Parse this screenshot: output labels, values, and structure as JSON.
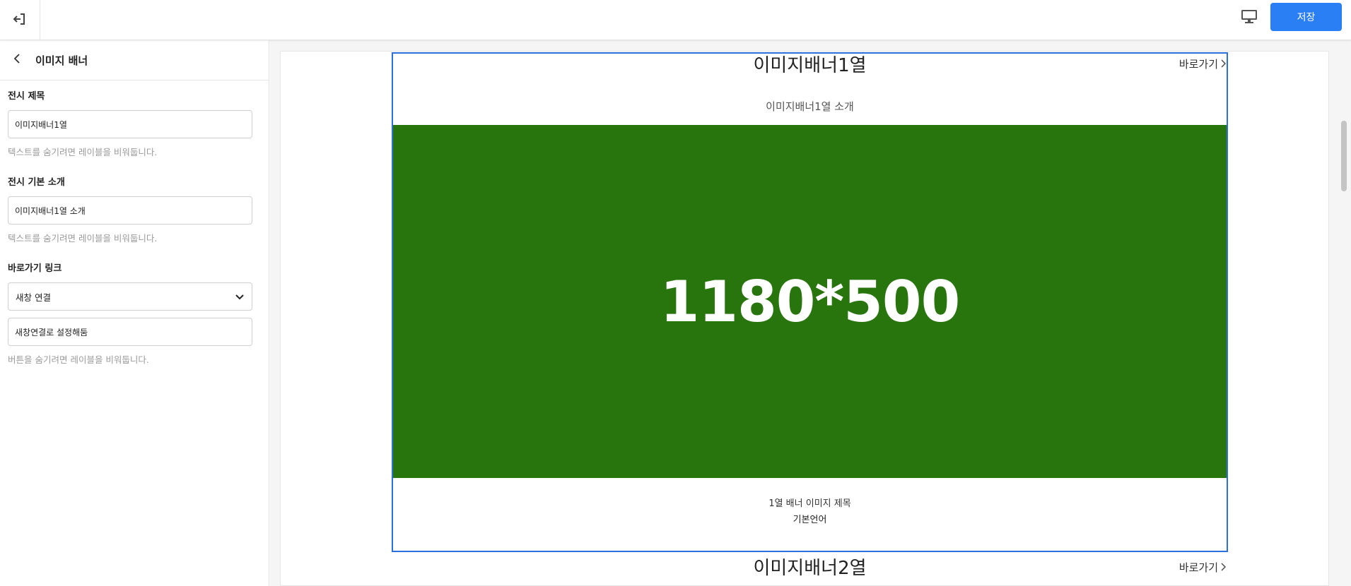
{
  "topbar": {
    "exit_icon": "exit-arrow-icon",
    "monitor_icon": "monitor-icon",
    "save_label": "저장"
  },
  "panel": {
    "title": "이미지 배너",
    "fields": {
      "title_label": "전시 제목",
      "title_value": "이미지배너1열",
      "title_help": "텍스트를 숨기려면 레이블을 비워둡니다.",
      "intro_label": "전시 기본 소개",
      "intro_value": "이미지배너1열 소개",
      "intro_help": "텍스트를 숨기려면 레이블을 비워둡니다.",
      "link_label": "바로가기 링크",
      "link_select_value": "새창 연결",
      "link_text_value": "새창연결로 설정해둠",
      "link_help": "버튼을 숨기려면 레이블을 비워둡니다."
    }
  },
  "preview": {
    "block1": {
      "title": "이미지배너1열",
      "more_label": "바로가기",
      "subtitle": "이미지배너1열 소개",
      "banner_text": "1180*500",
      "banner_color": "#28740d",
      "caption": "1열 배너 이미지 제목",
      "caption_lang": "기본언어"
    },
    "block2": {
      "title": "이미지배너2열",
      "more_label": "바로가기"
    }
  },
  "colors": {
    "accent": "#2b7ff5",
    "selection_border": "#2e6fe0"
  }
}
